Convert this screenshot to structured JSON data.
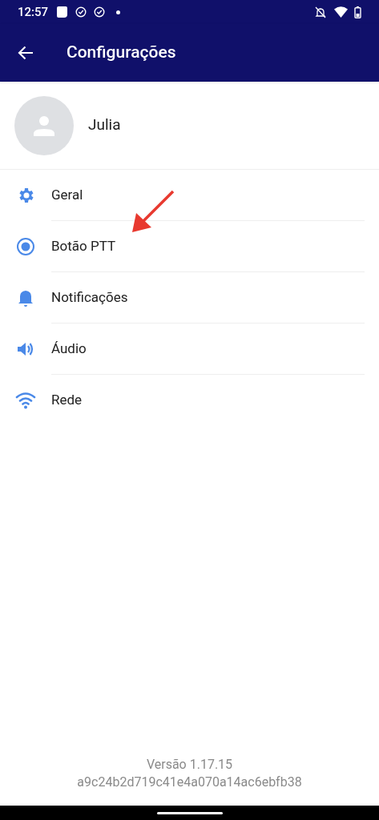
{
  "status_bar": {
    "time": "12:57"
  },
  "app_bar": {
    "title": "Configurações"
  },
  "profile": {
    "name": "Julia"
  },
  "menu": [
    {
      "kind": "gear",
      "label": "Geral"
    },
    {
      "kind": "radio",
      "label": "Botão PTT"
    },
    {
      "kind": "bell",
      "label": "Notificações"
    },
    {
      "kind": "speaker",
      "label": "Áudio"
    },
    {
      "kind": "wifi",
      "label": "Rede"
    }
  ],
  "footer": {
    "version": "Versão 1.17.15",
    "build": "a9c24b2d719c41e4a070a14ac6ebfb38"
  }
}
